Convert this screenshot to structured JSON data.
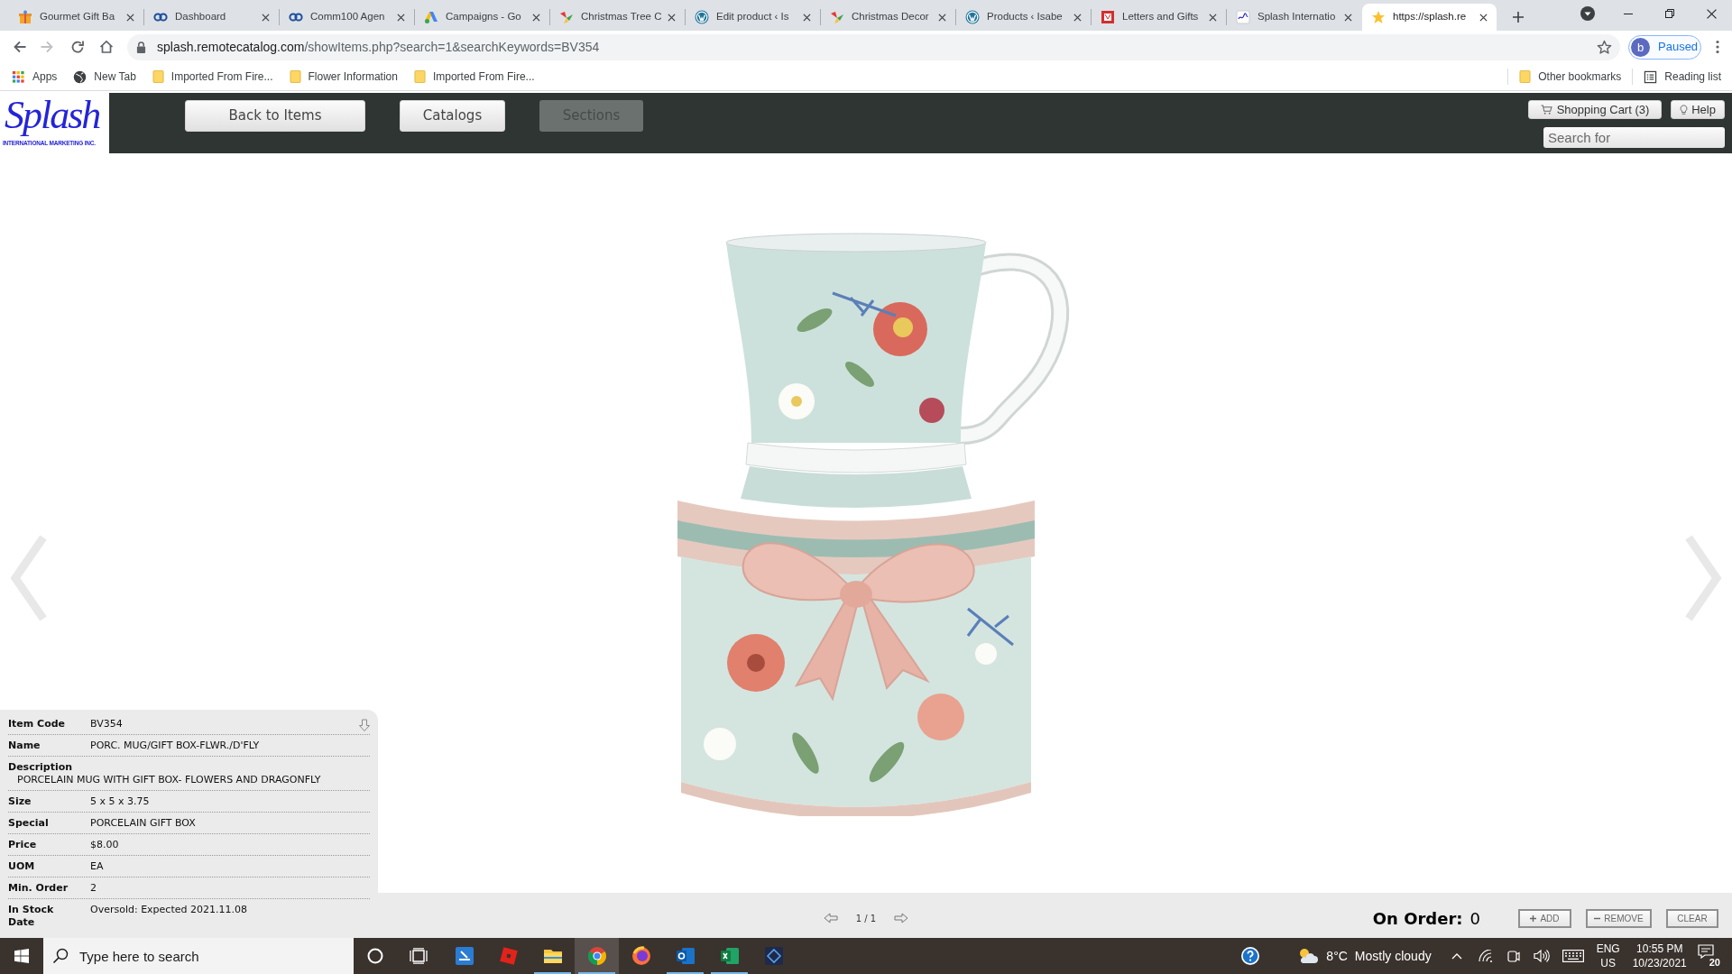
{
  "browser": {
    "tabs": [
      {
        "title": "Gourmet Gift Ba",
        "selected": false
      },
      {
        "title": "Dashboard",
        "selected": false
      },
      {
        "title": "Comm100 Agen",
        "selected": false
      },
      {
        "title": "Campaigns - Go",
        "selected": false
      },
      {
        "title": "Christmas Tree C",
        "selected": false
      },
      {
        "title": "Edit product ‹ Is",
        "selected": false
      },
      {
        "title": "Christmas Decor",
        "selected": false
      },
      {
        "title": "Products ‹ Isabe",
        "selected": false
      },
      {
        "title": "Letters and Gifts",
        "selected": false
      },
      {
        "title": "Splash Internatio",
        "selected": false
      },
      {
        "title": "https://splash.re",
        "selected": true
      }
    ],
    "can_go_forward": false,
    "address": {
      "host": "splash.remotecatalog.com",
      "path": "/showItems.php?search=1&searchKeywords=BV354"
    },
    "profile": {
      "initial": "b",
      "status": "Paused"
    },
    "bookmarks": [
      {
        "kind": "apps",
        "label": "Apps"
      },
      {
        "kind": "page",
        "label": "New Tab"
      },
      {
        "kind": "folder",
        "label": "Imported From Fire..."
      },
      {
        "kind": "folder",
        "label": "Flower Information"
      },
      {
        "kind": "folder",
        "label": "Imported From Fire..."
      }
    ],
    "bookmarks_right": [
      {
        "kind": "folder",
        "label": "Other bookmarks"
      },
      {
        "kind": "reading",
        "label": "Reading list"
      }
    ]
  },
  "header": {
    "logo": {
      "wordmark": "Splash",
      "tagline": "INTERNATIONAL MARKETING INC."
    },
    "nav": [
      {
        "label": "Back to Items",
        "disabled": false
      },
      {
        "label": "Catalogs",
        "disabled": false
      },
      {
        "label": "Sections",
        "disabled": true
      }
    ],
    "cart": "Shopping Cart (3)",
    "help": "Help",
    "search": {
      "placeholder": "Search for"
    }
  },
  "item_details": [
    {
      "kind": "inline",
      "label": "Item Code",
      "value": "BV354"
    },
    {
      "kind": "inline",
      "label": "Name",
      "value": "PORC. MUG/GIFT BOX-FLWR./D'FLY"
    },
    {
      "kind": "stacked",
      "label": "Description",
      "value": "PORCELAIN MUG WITH GIFT BOX- FLOWERS AND DRAGONFLY"
    },
    {
      "kind": "inline",
      "label": "Size",
      "value": "5 x 5 x 3.75"
    },
    {
      "kind": "inline",
      "label": "Special",
      "value": "PORCELAIN GIFT BOX"
    },
    {
      "kind": "inline",
      "label": "Price",
      "value": "$8.00"
    },
    {
      "kind": "inline",
      "label": "UOM",
      "value": "EA"
    },
    {
      "kind": "inline",
      "label": "Min. Order",
      "value": "2"
    },
    {
      "kind": "inline",
      "label": "In Stock Date",
      "value": "Oversold: Expected 2021.11.08"
    }
  ],
  "pager": {
    "position": "1 / 1"
  },
  "order": {
    "label": "On Order:",
    "value": "0",
    "buttons": [
      {
        "kind": "add",
        "label": "ADD"
      },
      {
        "kind": "remove",
        "label": "REMOVE"
      },
      {
        "kind": "clear",
        "label": "CLEAR"
      }
    ]
  },
  "taskbar": {
    "search": {
      "placeholder": "Type here to search"
    },
    "apps": [
      {
        "running": false,
        "selected": false
      },
      {
        "running": false,
        "selected": false
      },
      {
        "running": true,
        "selected": false
      },
      {
        "running": true,
        "selected": true
      },
      {
        "running": false,
        "selected": false
      },
      {
        "running": true,
        "selected": false
      },
      {
        "running": true,
        "selected": false
      },
      {
        "running": false,
        "selected": false
      }
    ],
    "weather": {
      "temperature": "8°C",
      "condition": "Mostly cloudy"
    },
    "language": {
      "input": "ENG",
      "region": "US"
    },
    "clock": {
      "time": "10:55 PM",
      "date": "10/23/2021"
    },
    "notifications": "20"
  }
}
